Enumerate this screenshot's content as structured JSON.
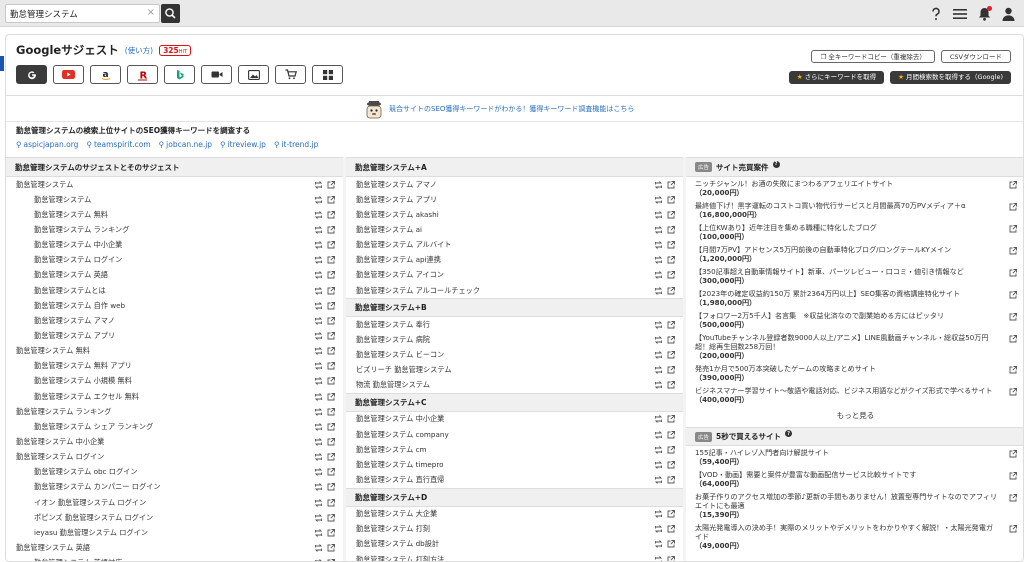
{
  "search": {
    "value": "勤怠管理システム",
    "clear_icon": "×"
  },
  "header_icons": [
    "help-icon",
    "menu-icon",
    "bell-icon",
    "user-icon"
  ],
  "page": {
    "title": "Googleサジェスト",
    "howto": "(使い方)",
    "count_num": "325",
    "count_unit": "HIT",
    "tools": [
      "google",
      "youtube",
      "amazon",
      "rakuten",
      "bing",
      "video",
      "image",
      "shopping",
      "apps"
    ]
  },
  "buttons": {
    "copy_all": "全キーワードコピー（重複除去）",
    "csv": "CSVダウンロード",
    "get_more": "さらにキーワードを取得",
    "get_volume": "月間検索数を取得する（Google)"
  },
  "promo": "競合サイトのSEO獲得キーワードがわかる！獲得キーワード調査機能はこちら",
  "seo": {
    "title": "勤怠管理システムの検索上位サイトのSEO獲得キーワードを調査する",
    "sites": [
      "aspicjapan.org",
      "teamspirit.com",
      "jobcan.ne.jp",
      "itreview.jp",
      "it-trend.jp"
    ]
  },
  "col1": {
    "header": "勤怠管理システムのサジェストとそのサジェスト",
    "rows": [
      {
        "kw": "勤怠管理システム",
        "sub": false
      },
      {
        "kw": "勤怠管理システム",
        "sub": true
      },
      {
        "kw": "勤怠管理システム 無料",
        "sub": true
      },
      {
        "kw": "勤怠管理システム ランキング",
        "sub": true
      },
      {
        "kw": "勤怠管理システム 中小企業",
        "sub": true
      },
      {
        "kw": "勤怠管理システム ログイン",
        "sub": true
      },
      {
        "kw": "勤怠管理システム 英語",
        "sub": true
      },
      {
        "kw": "勤怠管理システムとは",
        "sub": true
      },
      {
        "kw": "勤怠管理システム 自作 web",
        "sub": true
      },
      {
        "kw": "勤怠管理システム アマノ",
        "sub": true
      },
      {
        "kw": "勤怠管理システム アプリ",
        "sub": true
      },
      {
        "kw": "勤怠管理システム 無料",
        "sub": false
      },
      {
        "kw": "勤怠管理システム 無料 アプリ",
        "sub": true
      },
      {
        "kw": "勤怠管理システム 小規模 無料",
        "sub": true
      },
      {
        "kw": "勤怠管理システム エクセル 無料",
        "sub": true
      },
      {
        "kw": "勤怠管理システム ランキング",
        "sub": false
      },
      {
        "kw": "勤怠管理システム シェア ランキング",
        "sub": true
      },
      {
        "kw": "勤怠管理システム 中小企業",
        "sub": false
      },
      {
        "kw": "勤怠管理システム ログイン",
        "sub": false
      },
      {
        "kw": "勤怠管理システム obc ログイン",
        "sub": true
      },
      {
        "kw": "勤怠管理システム カンパニー ログイン",
        "sub": true
      },
      {
        "kw": "イオン 勤怠管理システム ログイン",
        "sub": true
      },
      {
        "kw": "ポピンズ 勤怠管理システム ログイン",
        "sub": true
      },
      {
        "kw": "ieyasu 勤怠管理システム ログイン",
        "sub": true
      },
      {
        "kw": "勤怠管理システム 英語",
        "sub": false
      },
      {
        "kw": "勤怠管理システム 英語対応",
        "sub": true
      }
    ]
  },
  "col2": {
    "groups": [
      {
        "header": "勤怠管理システム+A",
        "rows": [
          "勤怠管理システム アマノ",
          "勤怠管理システム アプリ",
          "勤怠管理システム akashi",
          "勤怠管理システム ai",
          "勤怠管理システム アルバイト",
          "勤怠管理システム api連携",
          "勤怠管理システム アイコン",
          "勤怠管理システム アルコールチェック"
        ]
      },
      {
        "header": "勤怠管理システム+B",
        "rows": [
          "勤怠管理システム 奉行",
          "勤怠管理システム 病院",
          "勤怠管理システム ビーコン",
          "ビズリーチ 勤怠管理システム",
          "物流 勤怠管理システム"
        ]
      },
      {
        "header": "勤怠管理システム+C",
        "rows": [
          "勤怠管理システム 中小企業",
          "勤怠管理システム company",
          "勤怠管理システム cm",
          "勤怠管理システム timepro",
          "勤怠管理システム 直行直帰"
        ]
      },
      {
        "header": "勤怠管理システム+D",
        "rows": [
          "勤怠管理システム 大企業",
          "勤怠管理システム 打刻",
          "勤怠管理システム db設計",
          "勤怠管理システム 打刻方法"
        ]
      }
    ]
  },
  "col3": {
    "ad_label": "広告",
    "header1": "サイト売買案件",
    "ads1": [
      {
        "text": "ニッチジャンル！お酒の失敗にまつわるアフェリエイトサイト",
        "price": "（20,000円）"
      },
      {
        "text": "最終値下げ！黒字運転のコストコ買い物代行サービスと月間最高70万PVメディア＋α",
        "price": "（16,800,000円）"
      },
      {
        "text": "【上位KWあり】近年注目を集める職種に特化したブログ",
        "price": "（100,000円）"
      },
      {
        "text": "【月間7万PV】アドセンス5万円前後の自動車特化ブログ/ロングテールKYメイン",
        "price": "（1,200,000円）"
      },
      {
        "text": "【350記事超え自動車情報サイト】新車、パーツレビュー・口コミ・値引き情報など",
        "price": "（300,000円）"
      },
      {
        "text": "【2023年の確定収益約150万 累計2364万円以上】SEO集客の資格講座特化サイト",
        "price": "（1,980,000円）"
      },
      {
        "text": "【フォロワー2万5千人】名言集　※収益化済なので副業始める方にはピッタリ",
        "price": "（500,000円）"
      },
      {
        "text": "【YouTubeチャンネル登録者数9000人以上/アニメ】LINE風動画チャンネル・総収益50万円超！総再生回数258万回！",
        "price": "（200,000円）"
      },
      {
        "text": "発売1か月で500万本突破したゲームの攻略まとめサイト",
        "price": "（390,000円）"
      },
      {
        "text": "ビジネスマナー学習サイト〜敬語や電話対応、ビジネス用語などがクイズ形式で学べるサイト",
        "price": "（400,000円）"
      }
    ],
    "more": "もっと見る",
    "header2": "5秒で買えるサイト",
    "ads2": [
      {
        "text": "155記事・ハイレゾ入門者向け解説サイト",
        "price": "（59,400円）"
      },
      {
        "text": "【VOD・動画】需要と案件が豊富な動画配信サービス比較サイトです",
        "price": "（64,000円）"
      },
      {
        "text": "お菓子作りのアクセス増加の季節♪更新の手間もありません！放置型専門サイトなのでアフィリエイトにも最適",
        "price": "（15,390円）"
      },
      {
        "text": "太陽光発電導入の決め手！実際のメリットやデメリットをわかりやすく解説！・太陽光発電ガイド",
        "price": "（49,000円）"
      }
    ]
  },
  "colors": {
    "accent": "#2a6ec0",
    "count_red": "#dd1111",
    "dark": "#3a3a3a",
    "star": "#f6b700",
    "badge": "#e61e28"
  }
}
